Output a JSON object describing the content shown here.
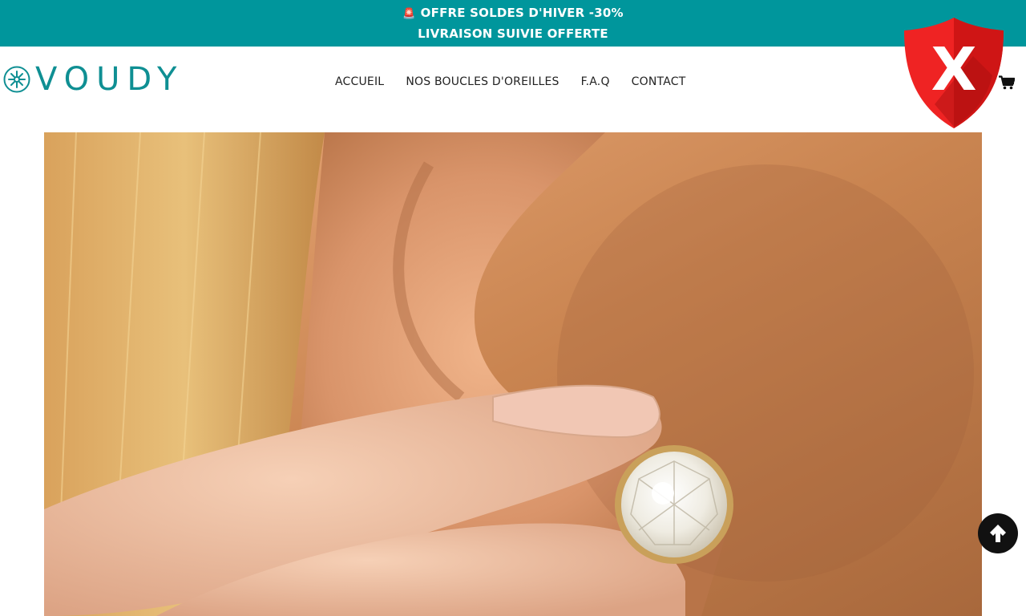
{
  "promo": {
    "emoji": "🚨",
    "line1": "OFFRE SOLDES D'HIVER -30%",
    "line2": "LIVRAISON SUIVIE OFFERTE"
  },
  "brand": {
    "name": "VOUDY",
    "color": "#0f8f93",
    "promo_bg": "#00969c"
  },
  "nav": {
    "items": [
      {
        "label": "ACCUEIL"
      },
      {
        "label": "NOS BOUCLES D'OREILLES"
      },
      {
        "label": "F.A.Q"
      },
      {
        "label": "CONTACT"
      }
    ]
  },
  "icons": {
    "cart": "cart-icon",
    "shield": "red-shield-x-icon",
    "scroll_top": "arrow-up-icon"
  },
  "hero": {
    "image_subject": "close-up of a diamond stud earring held at an ear"
  }
}
